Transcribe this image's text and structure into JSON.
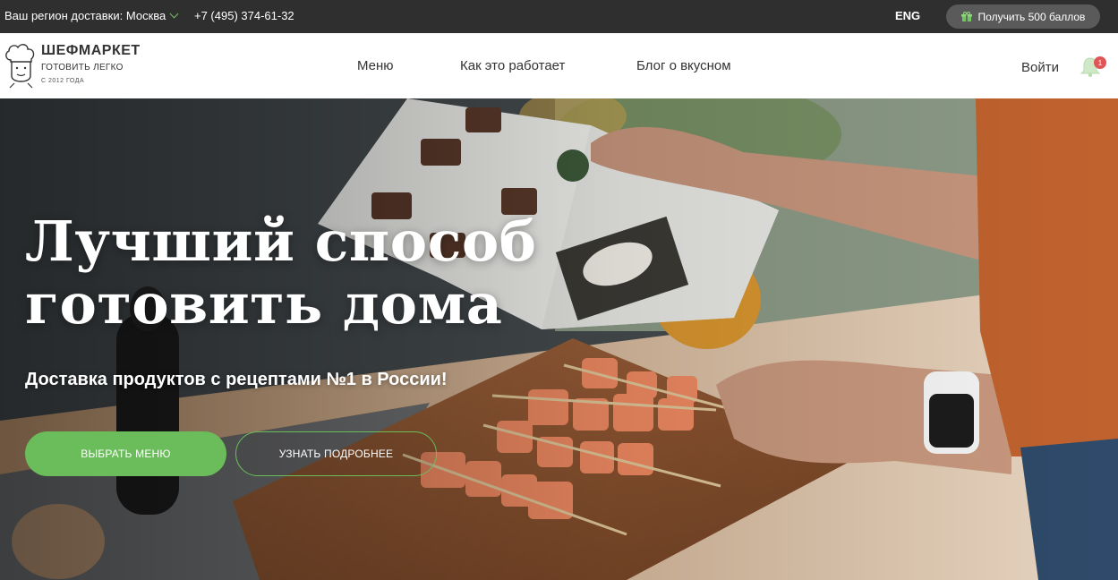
{
  "topbar": {
    "region_label": "Ваш регион доставки: Москва",
    "phone": "+7 (495) 374-61-32",
    "language": "ENG",
    "bonus_button": "Получить 500 баллов"
  },
  "logo": {
    "title": "ШЕФМАРКЕТ",
    "subtitle": "ГОТОВИТЬ ЛЕГКО",
    "since": "С 2012 ГОДА"
  },
  "nav": {
    "items": [
      "Меню",
      "Как это работает",
      "Блог о вкусном"
    ],
    "login": "Войти",
    "notifications_count": "1"
  },
  "hero": {
    "title_line1": "Лучший способ",
    "title_line2": "готовить дома",
    "subtitle": "Доставка продуктов с рецептами №1 в России!",
    "primary_button": "ВЫБРАТЬ МЕНЮ",
    "secondary_button": "УЗНАТЬ ПОДРОБНЕЕ"
  },
  "colors": {
    "accent": "#6bbd5b",
    "topbar_bg": "#2f2f2f",
    "badge": "#e05555"
  },
  "icons": [
    "chevron-down-icon",
    "gift-icon",
    "chef-logo-icon",
    "bell-icon"
  ]
}
